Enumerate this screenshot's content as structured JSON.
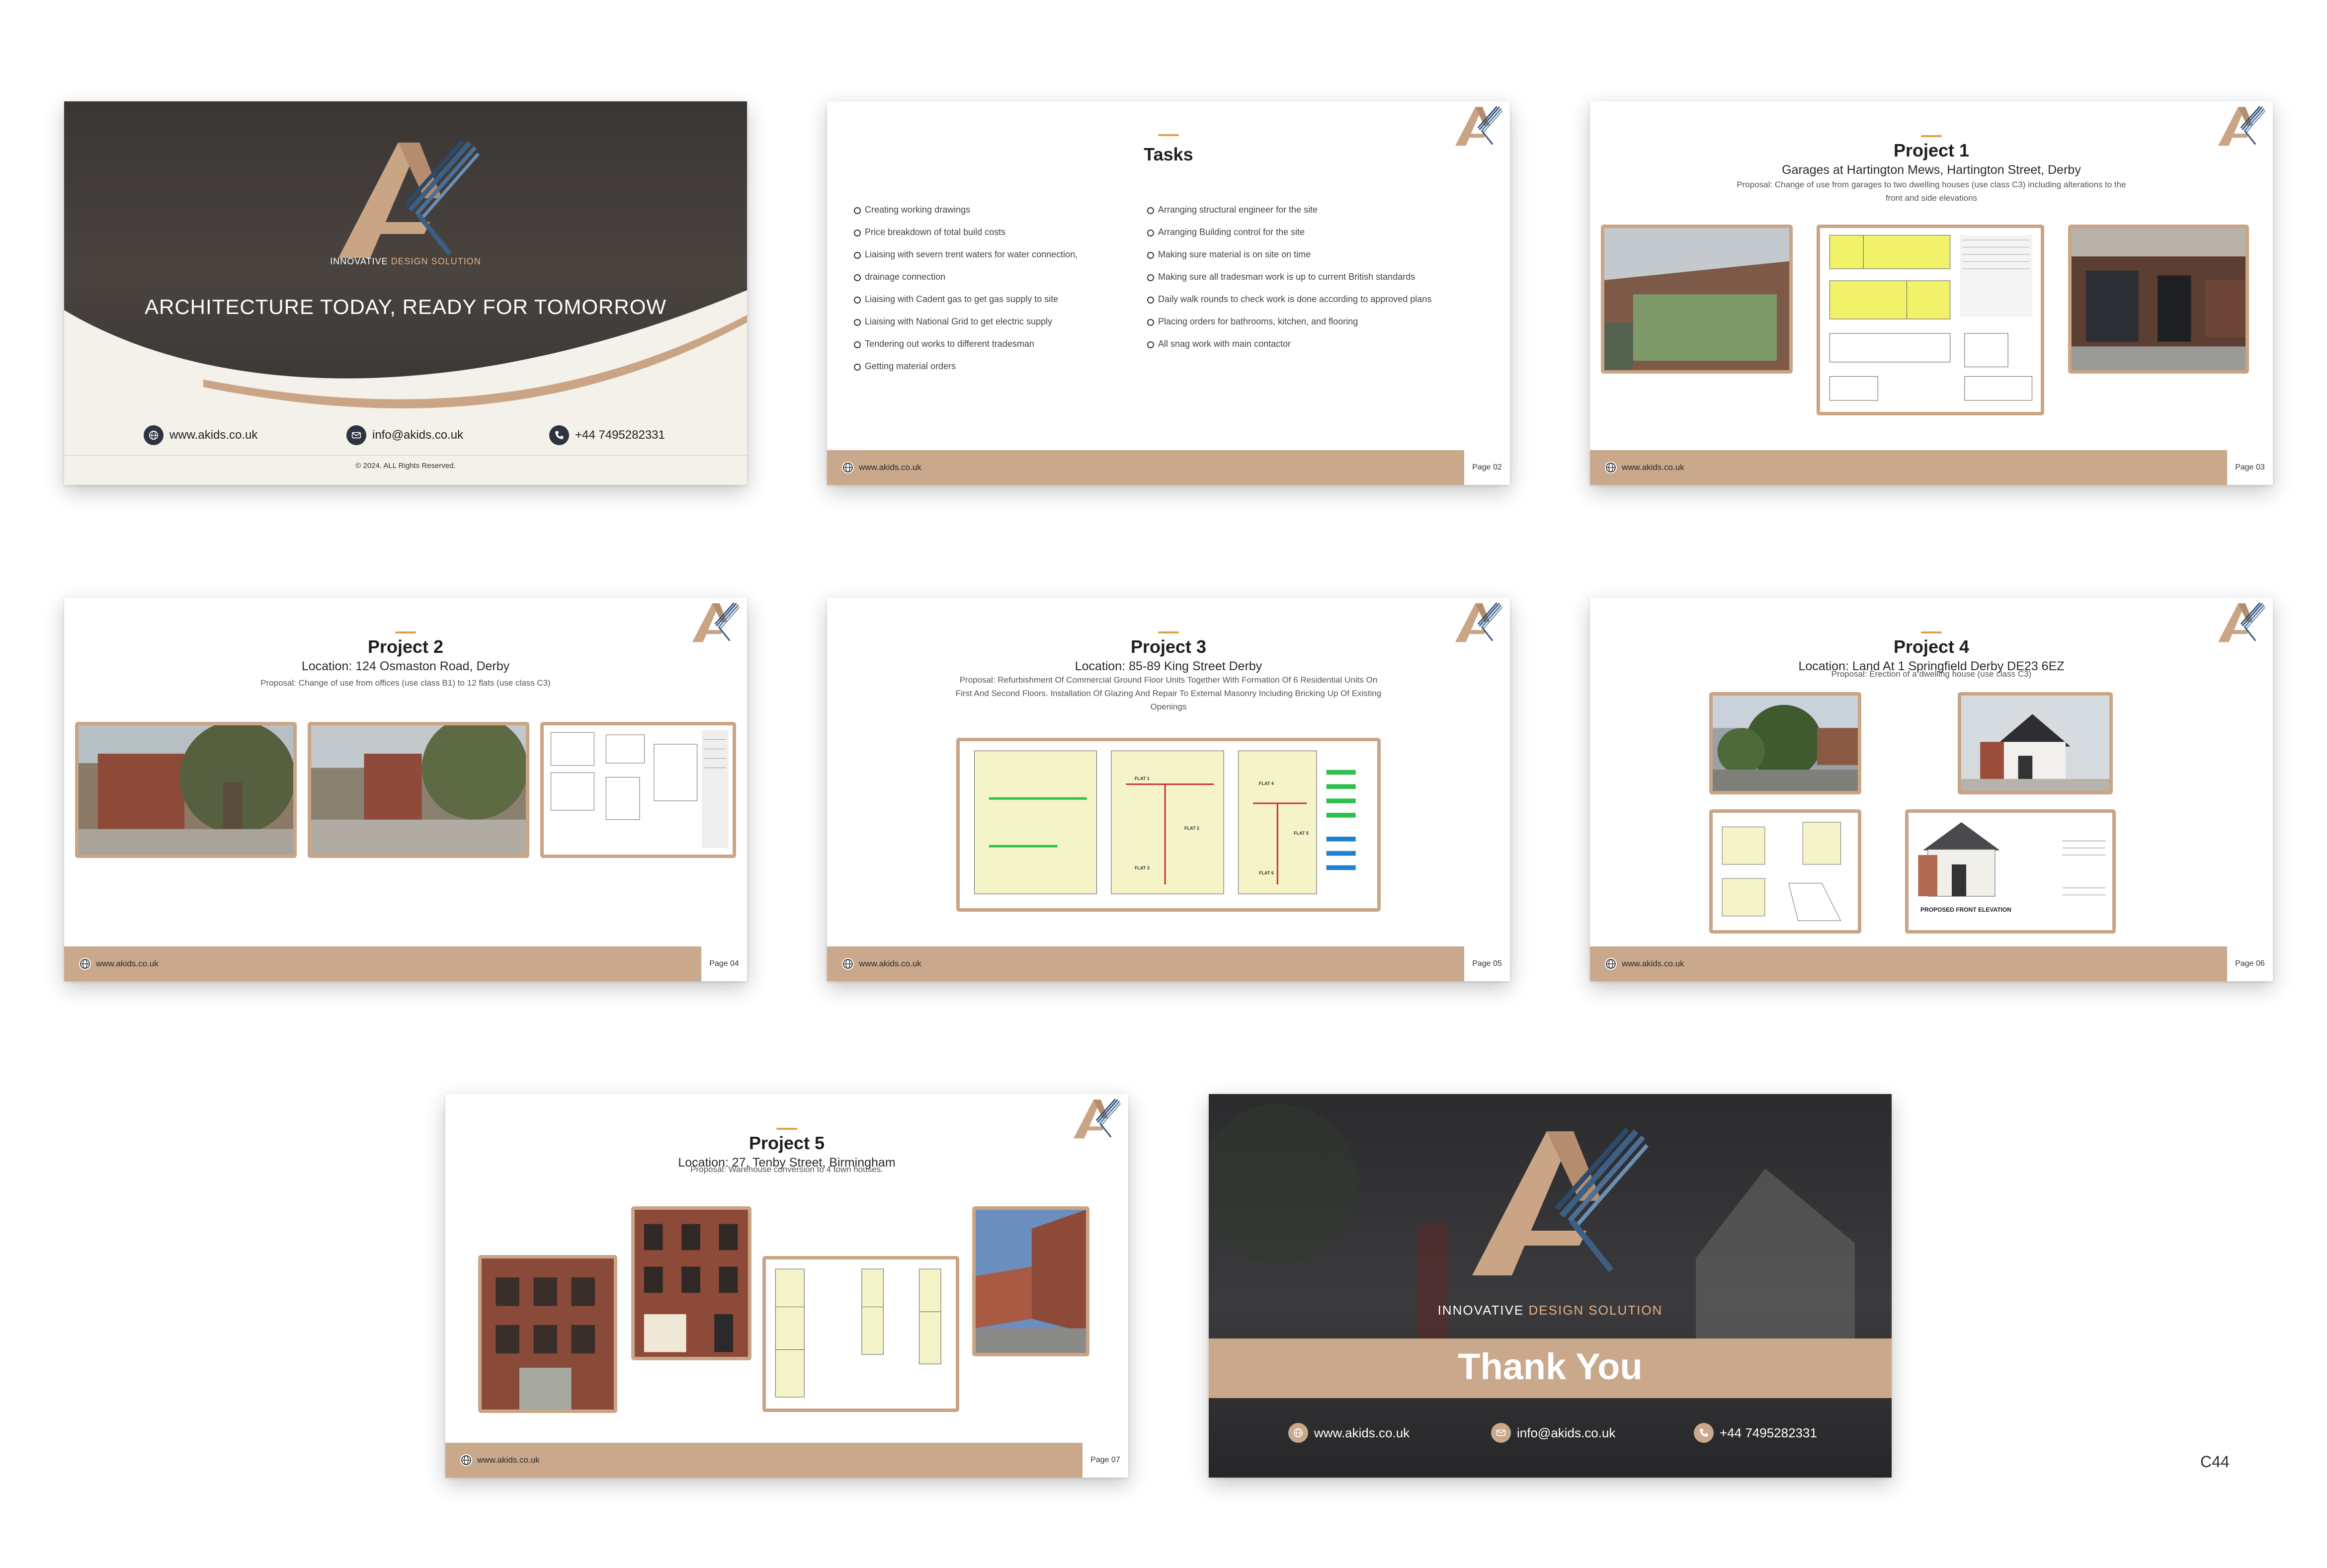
{
  "brand": {
    "tagline_bold": "INNOVATIVE",
    "tagline_rest": "DESIGN SOLUTION",
    "colors": {
      "accent": "#caa88b",
      "gold": "#e0a040",
      "navy": "#2d3440"
    }
  },
  "contact": {
    "website": "www.akids.co.uk",
    "email": "info@akids.co.uk",
    "phone": "+44 7495282331"
  },
  "cover": {
    "heading": "ARCHITECTURE TODAY, READY FOR TOMORROW",
    "copyright": "© 2024. ALL Rights Reserved."
  },
  "tasks_slide": {
    "title": "Tasks",
    "page": "Page 02",
    "left": [
      "Creating working drawings",
      "Price breakdown of total build costs",
      "Liaising with severn trent waters for water connection,",
      "drainage connection",
      "Liaising with Cadent gas to get gas supply to site",
      "Liaising with National Grid to get electric supply",
      "Tendering out works to different tradesman",
      "Getting material orders"
    ],
    "right": [
      "Arranging structural engineer for the site",
      "Arranging Building control for the site",
      "Making sure material is on site on time",
      "Making sure all tradesman work is up to current British standards",
      "Daily walk rounds to check work is done according to approved plans",
      "Placing orders for bathrooms, kitchen, and flooring",
      "All snag work with main contactor"
    ]
  },
  "project1": {
    "title": "Project 1",
    "subtitle": "Garages at Hartington Mews, Hartington Street, Derby",
    "description": "Proposal: Change of use from garages to two dwelling houses (use class C3) including alterations to the front and side elevations",
    "page": "Page 03"
  },
  "project2": {
    "title": "Project 2",
    "subtitle": "Location: 124 Osmaston Road, Derby",
    "description": "Proposal: Change of use from offices (use class B1) to 12 flats (use class C3)",
    "page": "Page 04"
  },
  "project3": {
    "title": "Project 3",
    "subtitle": "Location: 85-89 King Street  Derby",
    "description": "Proposal: Refurbishment Of Commercial Ground Floor Units Together With Formation Of 6 Residential Units On First And Second Floors. Installation Of Glazing And Repair To External Masonry Including Bricking Up Of Existing Openings",
    "page": "Page 05",
    "flat_labels": [
      "FLAT 1",
      "FLAT 2",
      "FLAT 3",
      "FLAT 4",
      "FLAT 5",
      "FLAT 6"
    ]
  },
  "project4": {
    "title": "Project 4",
    "subtitle": "Location: Land At 1 Springfield  Derby  DE23 6EZ",
    "description": "Proposal: Erection of a dwelling house (use class C3)",
    "page": "Page 06",
    "elevation_label": "PROPOSED FRONT ELEVATION"
  },
  "project5": {
    "title": "Project 5",
    "subtitle": "Location: 27, Tenby Street, Birmingham",
    "description": "Proposal: Warehouse conversion to 4 town houses.",
    "page": "Page 07"
  },
  "closing": {
    "thanks": "Thank You"
  },
  "sheet_code": "C44"
}
